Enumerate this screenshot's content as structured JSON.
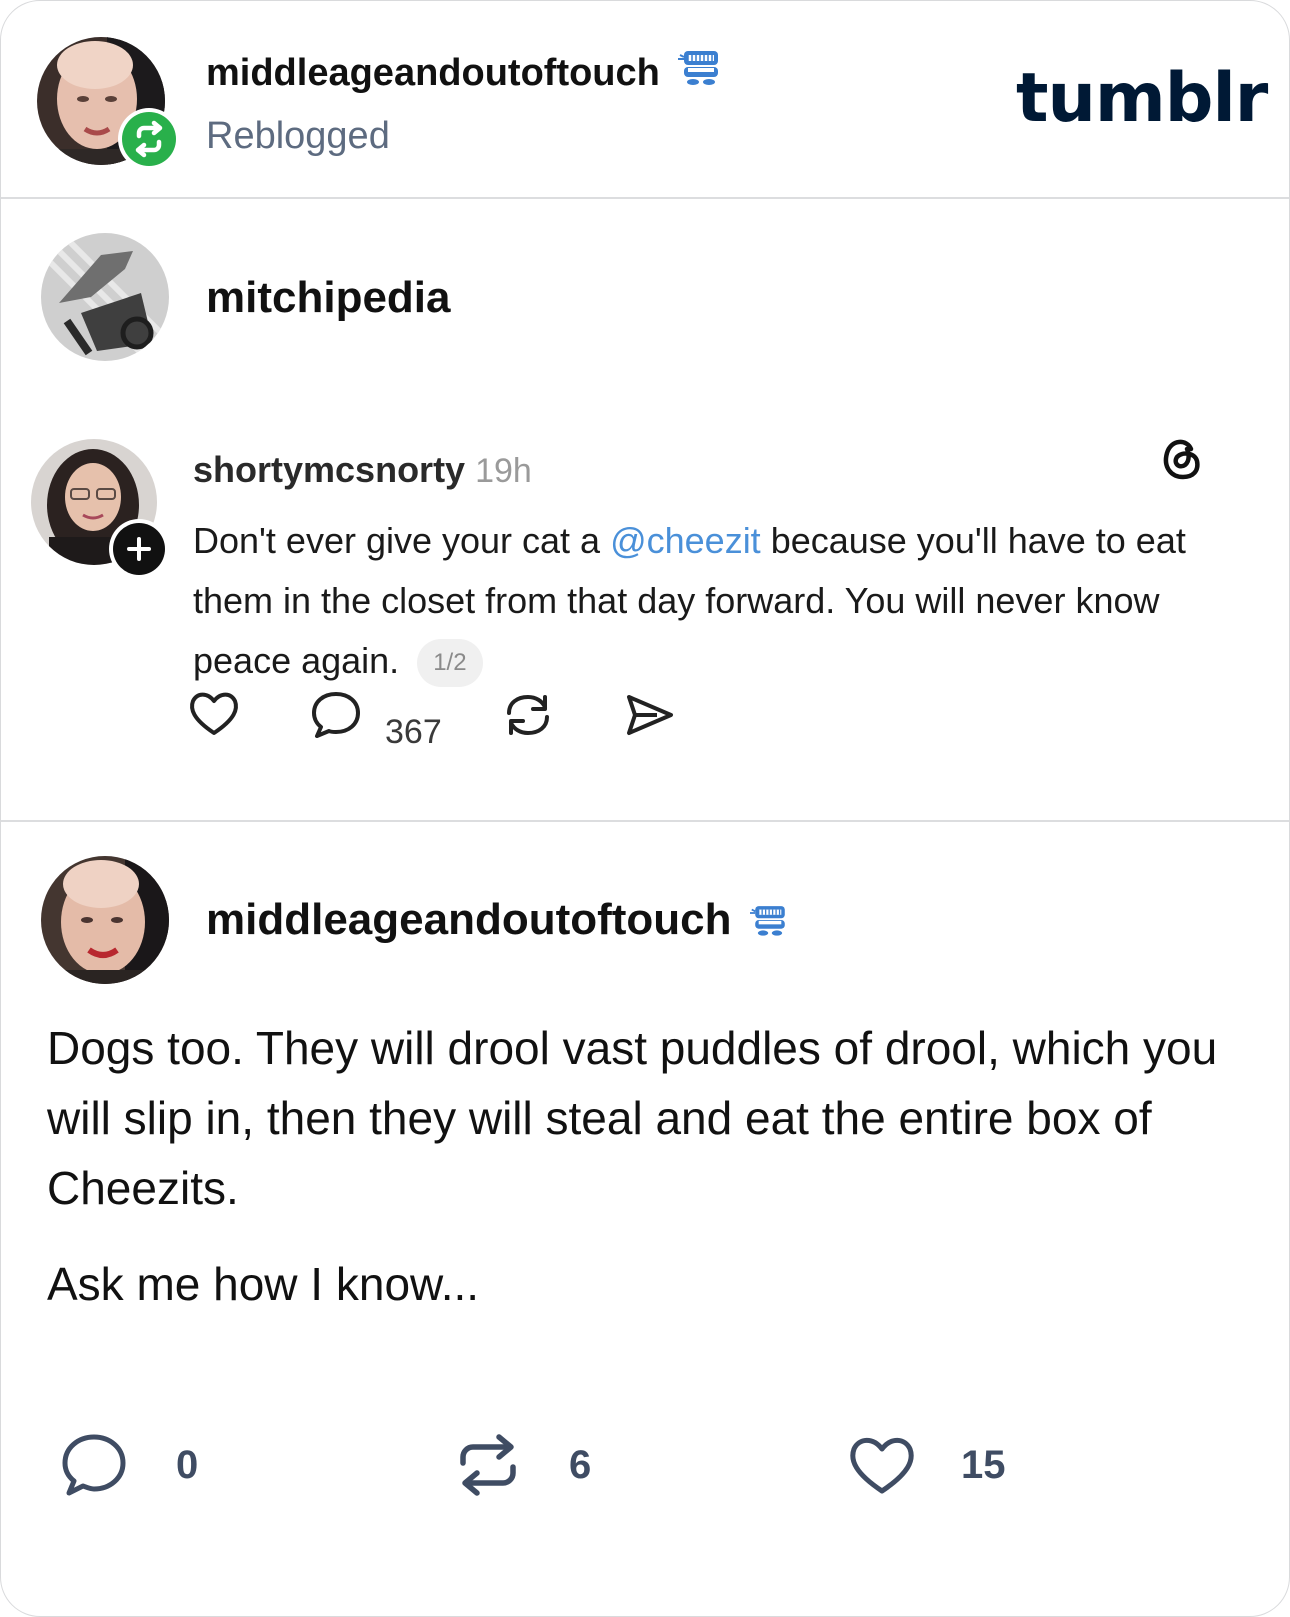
{
  "header": {
    "user": "middleageandoutoftouch",
    "status": "Reblogged",
    "brand": "tumblr",
    "avatar_icon": "profile-photo",
    "badge_icon": "reblog-icon",
    "badge_color": "#29b04b"
  },
  "source_post": {
    "blog": "mitchipedia",
    "embed": {
      "username": "shortymcsnorty",
      "time": "19h",
      "text_before": "Don't ever give your cat a ",
      "mention": "@cheezit",
      "text_after": " because you'll have to eat them in the closet from that day forward. You will never know peace again.",
      "page": "1/2",
      "comment_count": "367",
      "platform_icon": "threads-icon",
      "mention_color": "#4a90d9"
    }
  },
  "reblog": {
    "blog": "middleageandoutoftouch",
    "paragraphs": [
      "Dogs too. They will drool vast puddles of drool, which you will slip in, then they will steal and eat the entire box of Cheezits.",
      "Ask me how I know..."
    ]
  },
  "footer": {
    "comments": "0",
    "reblogs": "6",
    "likes": "15"
  }
}
